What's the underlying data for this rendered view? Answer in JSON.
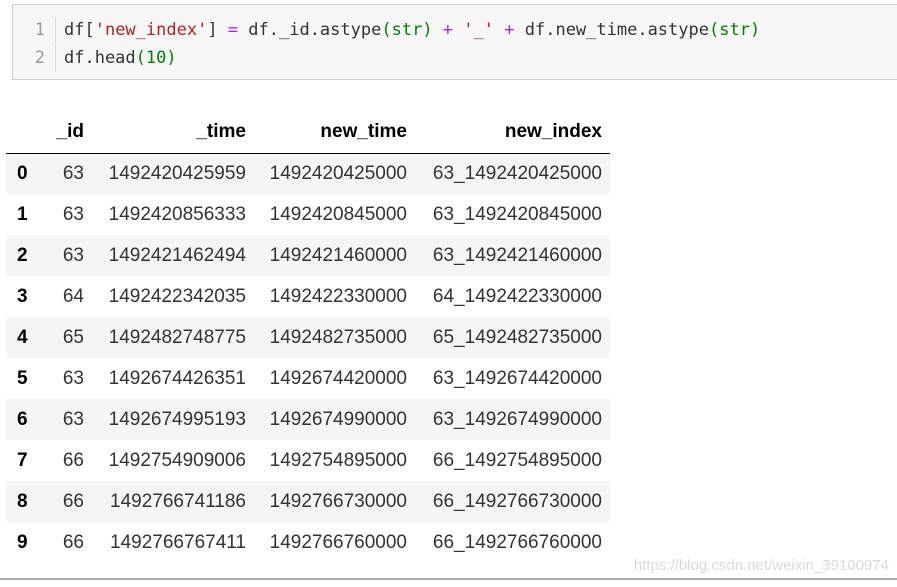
{
  "code_cell": {
    "lines": [
      {
        "number": "1",
        "tokens": {
          "t1": "df[",
          "t2": "'new_index'",
          "t3": "] ",
          "t4": "=",
          "t5": " df._id.astype",
          "t6": "(",
          "t7": "str",
          "t8": ") ",
          "t9": "+",
          "t10": " ",
          "t11": "'_'",
          "t12": " ",
          "t13": "+",
          "t14": " df.new_time.astype",
          "t15": "(",
          "t16": "str",
          "t17": ")"
        }
      },
      {
        "number": "2",
        "tokens": {
          "t1": "df.head",
          "t2": "(",
          "t3": "10",
          "t4": ")"
        }
      }
    ]
  },
  "table": {
    "columns": [
      "",
      "_id",
      "_time",
      "new_time",
      "new_index"
    ],
    "rows": [
      {
        "index": "0",
        "_id": "63",
        "_time": "1492420425959",
        "new_time": "1492420425000",
        "new_index": "63_1492420425000"
      },
      {
        "index": "1",
        "_id": "63",
        "_time": "1492420856333",
        "new_time": "1492420845000",
        "new_index": "63_1492420845000"
      },
      {
        "index": "2",
        "_id": "63",
        "_time": "1492421462494",
        "new_time": "1492421460000",
        "new_index": "63_1492421460000"
      },
      {
        "index": "3",
        "_id": "64",
        "_time": "1492422342035",
        "new_time": "1492422330000",
        "new_index": "64_1492422330000"
      },
      {
        "index": "4",
        "_id": "65",
        "_time": "1492482748775",
        "new_time": "1492482735000",
        "new_index": "65_1492482735000"
      },
      {
        "index": "5",
        "_id": "63",
        "_time": "1492674426351",
        "new_time": "1492674420000",
        "new_index": "63_1492674420000"
      },
      {
        "index": "6",
        "_id": "63",
        "_time": "1492674995193",
        "new_time": "1492674990000",
        "new_index": "63_1492674990000"
      },
      {
        "index": "7",
        "_id": "66",
        "_time": "1492754909006",
        "new_time": "1492754895000",
        "new_index": "66_1492754895000"
      },
      {
        "index": "8",
        "_id": "66",
        "_time": "1492766741186",
        "new_time": "1492766730000",
        "new_index": "66_1492766730000"
      },
      {
        "index": "9",
        "_id": "66",
        "_time": "1492766767411",
        "new_time": "1492766760000",
        "new_index": "66_1492766760000"
      }
    ]
  },
  "watermark": "https://blog.csdn.net/weixin_39100974",
  "colors": {
    "code_background": "#f7f7f7",
    "string": "#ba2121",
    "builtin": "#008000",
    "operator": "#aa22ff",
    "stripe": "#f5f5f5"
  }
}
